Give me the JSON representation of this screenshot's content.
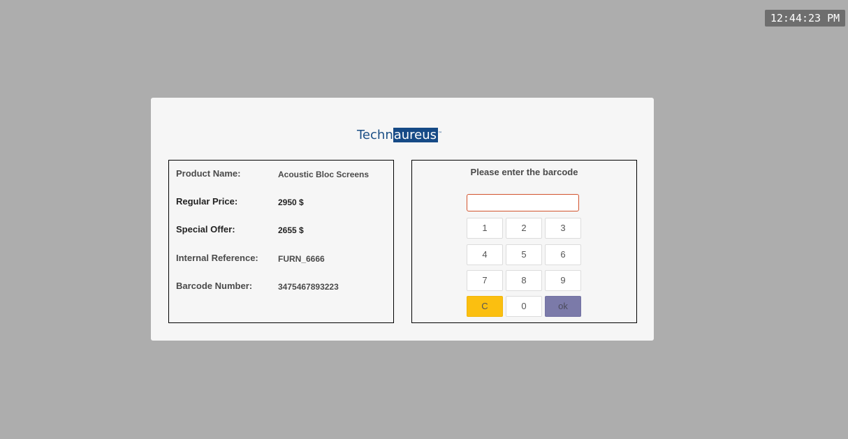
{
  "clock": {
    "time": "12:44:23 PM"
  },
  "logo": {
    "part1": "Techn",
    "part2": "aureus",
    "tm": "™"
  },
  "product": {
    "name_label": "Product Name:",
    "name_value": "Acoustic Bloc Screens",
    "regular_label": "Regular Price:",
    "regular_value": "2950 $",
    "offer_label": "Special Offer:",
    "offer_value": "2655 $",
    "ref_label": "Internal Reference:",
    "ref_value": "FURN_6666",
    "barcode_label": "Barcode Number:",
    "barcode_value": "3475467893223"
  },
  "keypad": {
    "title": "Please enter the barcode",
    "input_value": "",
    "keys": [
      "1",
      "2",
      "3",
      "4",
      "5",
      "6",
      "7",
      "8",
      "9",
      "C",
      "0",
      "ok"
    ]
  },
  "colors": {
    "background": "#adadad",
    "card": "#f6f6f6",
    "brand": "#164a86",
    "clear_key": "#fbbf10",
    "ok_key": "#7b7aa9",
    "input_border": "#d2532d"
  }
}
